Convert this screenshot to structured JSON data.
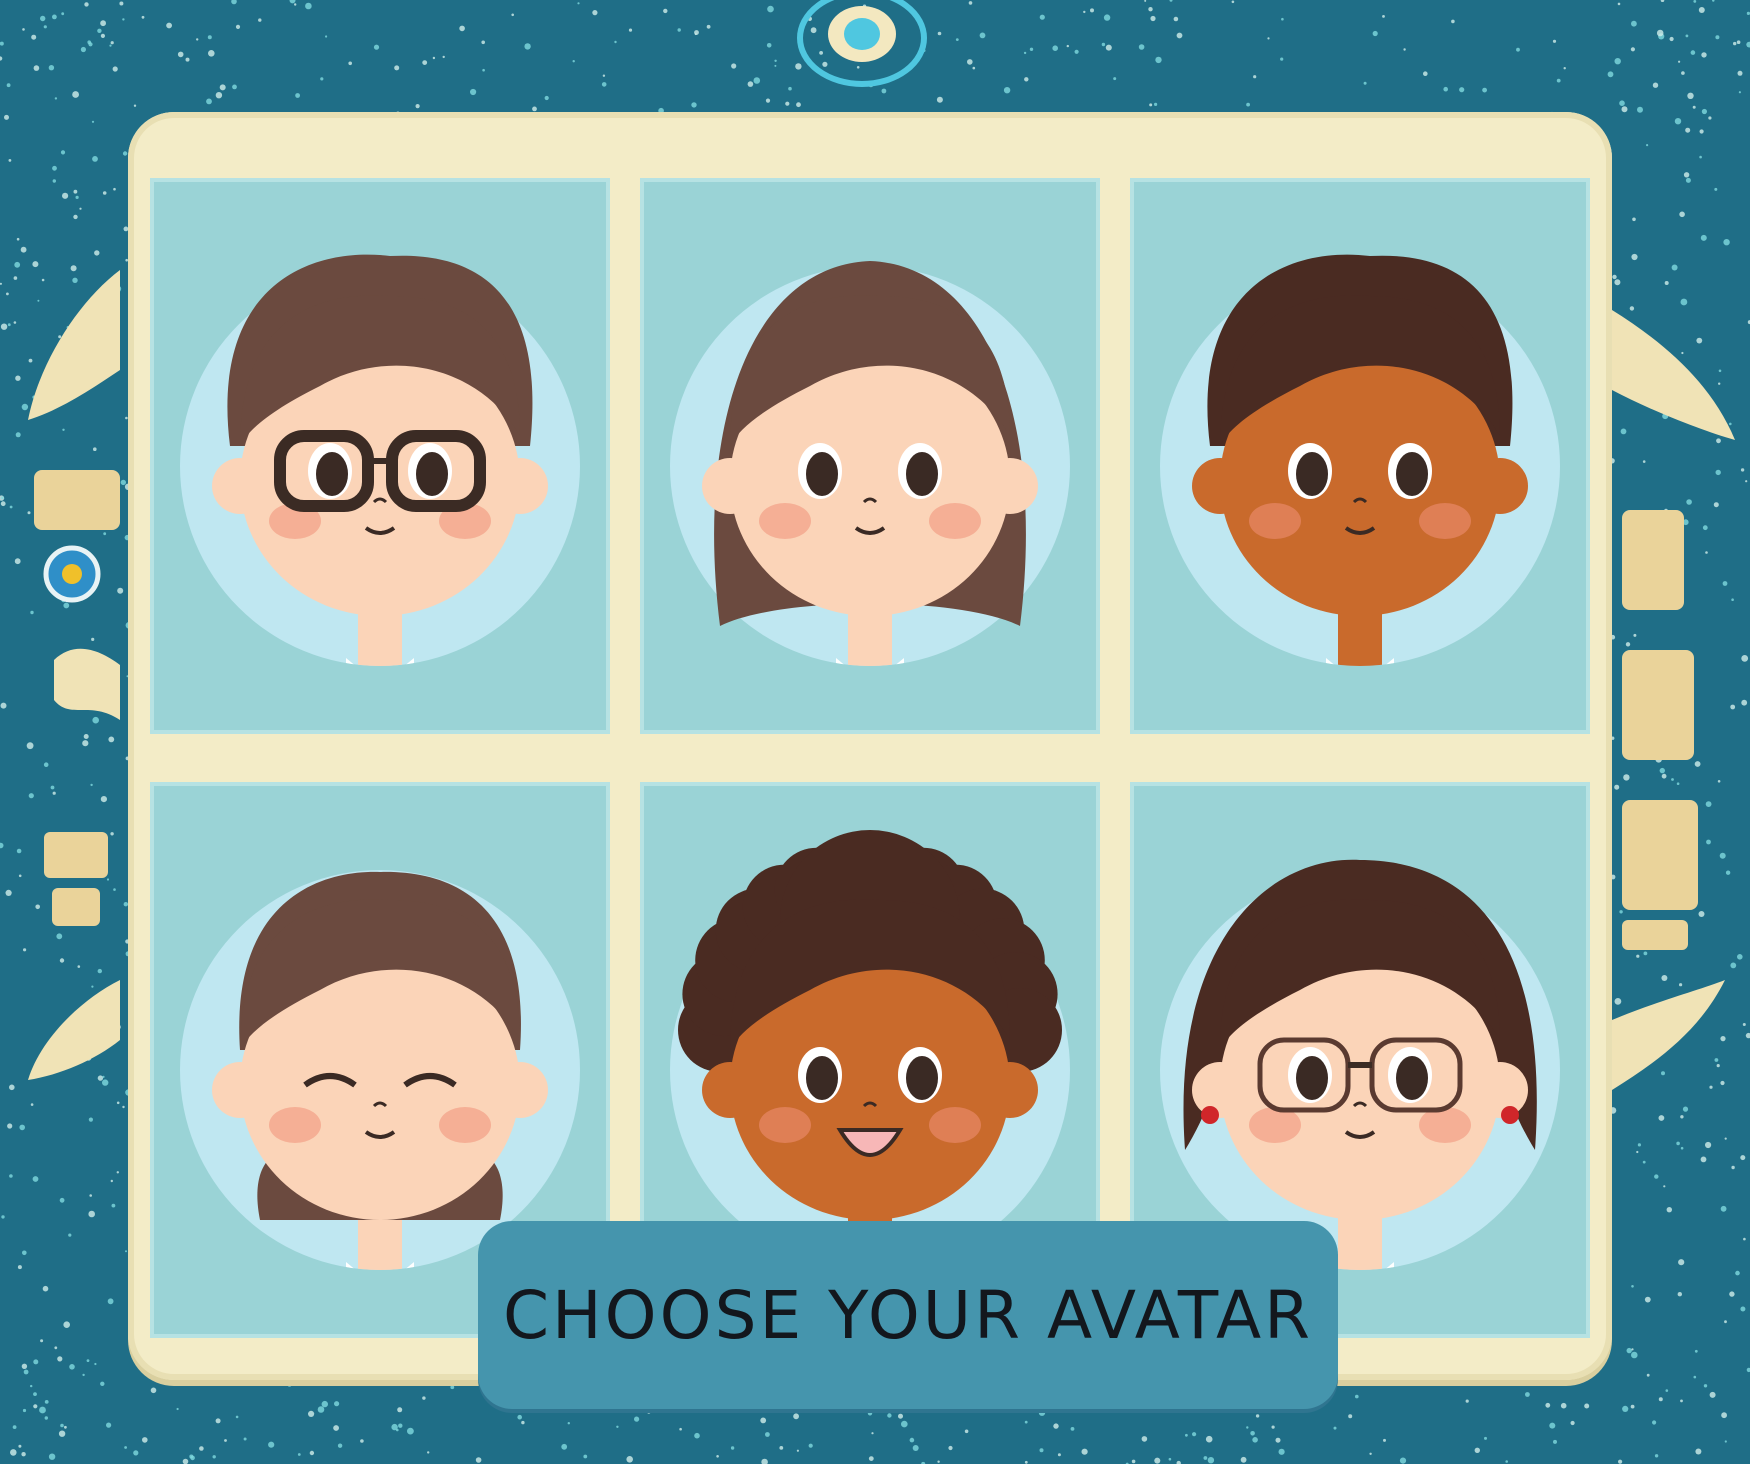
{
  "title": "CHOOSE YOUR AVATAR",
  "colors": {
    "background": "#1f6e87",
    "frame": "#f3ecc7",
    "tile": "#9ad3d6",
    "circle": "#bfe7f1",
    "button": "#4595ad",
    "button_text": "#13171d"
  },
  "avatars": [
    {
      "id": "boy-glasses",
      "skin": "#fbd4b8",
      "hair": "#6b4a3f",
      "shirt": "#f07b2d",
      "tie": "#2e2420",
      "glasses": true
    },
    {
      "id": "girl-long-hair",
      "skin": "#fbd4b8",
      "hair": "#6b4a3f",
      "shirt": "#f8efe4",
      "tie": null,
      "glasses": false
    },
    {
      "id": "boy-dark-skin",
      "skin": "#c96a2c",
      "hair": "#4a2b22",
      "shirt": "#c9261f",
      "tie": "#1f1a18",
      "glasses": false
    },
    {
      "id": "girl-smiling-eyes-closed",
      "skin": "#fbd4b8",
      "hair": "#6b4a3f",
      "shirt": "#f0b41f",
      "tie": null,
      "glasses": false
    },
    {
      "id": "boy-curly-hair",
      "skin": "#c96a2c",
      "hair": "#4a2b22",
      "shirt": "#4d7ea8",
      "tie": "#d9331f",
      "glasses": false
    },
    {
      "id": "girl-round-glasses",
      "skin": "#fbd4b8",
      "hair": "#4a2b22",
      "shirt": "#2fa564",
      "tie": null,
      "glasses": true
    }
  ]
}
